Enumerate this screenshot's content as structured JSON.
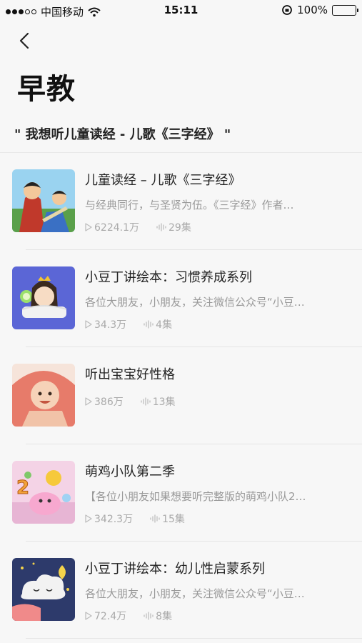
{
  "status_bar": {
    "carrier": "中国移动",
    "time": "15:11",
    "battery": "100%"
  },
  "header": {
    "title": "早教",
    "query": "\" 我想听儿童读经 - 儿歌《三字经》 \""
  },
  "items": [
    {
      "title": "儿童读经 – 儿歌《三字经》",
      "desc": "与经典同行，与圣贤为伍。《三字经》作者…",
      "plays": "6224.1万",
      "episodes": "29集"
    },
    {
      "title": "小豆丁讲绘本：习惯养成系列",
      "desc": "各位大朋友，小朋友，关注微信公众号“小豆…",
      "plays": "34.3万",
      "episodes": "4集"
    },
    {
      "title": "听出宝宝好性格",
      "desc": "",
      "plays": "386万",
      "episodes": "13集"
    },
    {
      "title": "萌鸡小队第二季",
      "desc": "【各位小朋友如果想要听完整版的萌鸡小队2…",
      "plays": "342.3万",
      "episodes": "15集"
    },
    {
      "title": "小豆丁讲绘本：幼儿性启蒙系列",
      "desc": "各位大朋友，小朋友，关注微信公众号“小豆…",
      "plays": "72.4万",
      "episodes": "8集"
    }
  ],
  "icons": {
    "back": "chevron-left-icon",
    "play": "play-icon",
    "episodes": "audio-wave-icon"
  }
}
